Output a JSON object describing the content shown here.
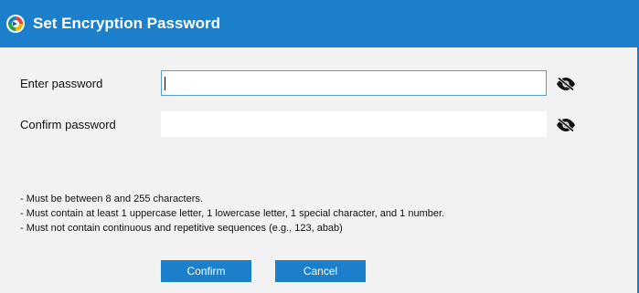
{
  "dialog": {
    "title": "Set Encryption Password",
    "app_icon": "app-logo-icon"
  },
  "form": {
    "password_label": "Enter password",
    "password_value": "",
    "confirm_label": "Confirm password",
    "confirm_value": "",
    "visibility_icon": "eye-hidden-icon"
  },
  "rules": [
    "- Must be between 8 and 255 characters.",
    "- Must contain at least 1 uppercase letter, 1 lowercase letter, 1 special character, and 1 number.",
    "- Must not contain continuous and repetitive sequences (e.g., 123, abab)"
  ],
  "buttons": {
    "confirm_label": "Confirm",
    "cancel_label": "Cancel"
  },
  "colors": {
    "accent": "#1b7fcb",
    "background": "#f2f2f2",
    "focus_border": "#5a9bd5"
  }
}
